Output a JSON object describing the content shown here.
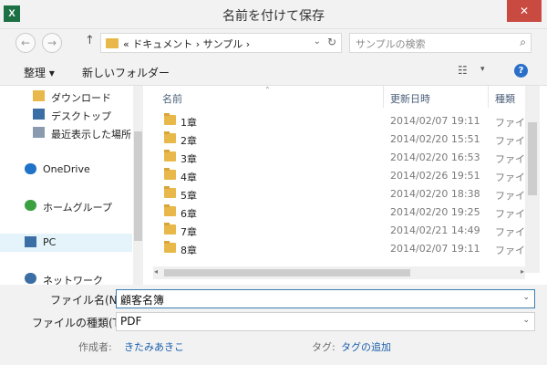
{
  "window": {
    "title": "名前を付けて保存",
    "app_icon": "X",
    "close_glyph": "✕"
  },
  "nav": {
    "back_glyph": "←",
    "forward_glyph": "→",
    "up_glyph": "↑",
    "address": "« ドキュメント › サンプル ›",
    "address_dropdown": "⌄",
    "refresh_glyph": "↻",
    "search_placeholder": "サンプルの検索",
    "search_glyph": "⌕"
  },
  "toolbar": {
    "organize": "整理 ▾",
    "new_folder": "新しいフォルダー",
    "view_glyph": "☷",
    "view_dropdown": "▾",
    "help_glyph": "?"
  },
  "sidebar": {
    "items": [
      {
        "label": "ダウンロード",
        "icon": "download-folder-icon",
        "color": "#e8b84a"
      },
      {
        "label": "デスクトップ",
        "icon": "desktop-icon",
        "color": "#3a6ea5"
      },
      {
        "label": "最近表示した場所",
        "icon": "recent-places-icon",
        "color": "#8a9bb0"
      },
      {
        "label": "OneDrive",
        "icon": "cloud-icon",
        "color": "#1e72c8"
      },
      {
        "label": "ホームグループ",
        "icon": "homegroup-icon",
        "color": "#3ba140"
      },
      {
        "label": "PC",
        "icon": "computer-icon",
        "color": "#3a6ea5"
      },
      {
        "label": "ネットワーク",
        "icon": "network-icon",
        "color": "#3a6ea5"
      }
    ]
  },
  "filelist": {
    "columns": {
      "name": "名前",
      "date": "更新日時",
      "type": "種類"
    },
    "rows": [
      {
        "name": "1章",
        "date": "2014/02/07 19:11",
        "type": "ファイル"
      },
      {
        "name": "2章",
        "date": "2014/02/20 15:51",
        "type": "ファイル"
      },
      {
        "name": "3章",
        "date": "2014/02/20 16:53",
        "type": "ファイル"
      },
      {
        "name": "4章",
        "date": "2014/02/26 19:51",
        "type": "ファイル"
      },
      {
        "name": "5章",
        "date": "2014/02/20 18:38",
        "type": "ファイル"
      },
      {
        "name": "6章",
        "date": "2014/02/20 19:25",
        "type": "ファイル"
      },
      {
        "name": "7章",
        "date": "2014/02/21 14:49",
        "type": "ファイル"
      },
      {
        "name": "8章",
        "date": "2014/02/07 19:11",
        "type": "ファイル"
      }
    ]
  },
  "form": {
    "filename_label": "ファイル名(N):",
    "filename_value": "顧客名簿",
    "filetype_label": "ファイルの種類(T):",
    "filetype_value": "PDF",
    "author_label": "作成者:",
    "author_value": "きたみあきこ",
    "tags_label": "タグ:",
    "tags_value": "タグの追加",
    "dropdown_glyph": "⌄"
  }
}
